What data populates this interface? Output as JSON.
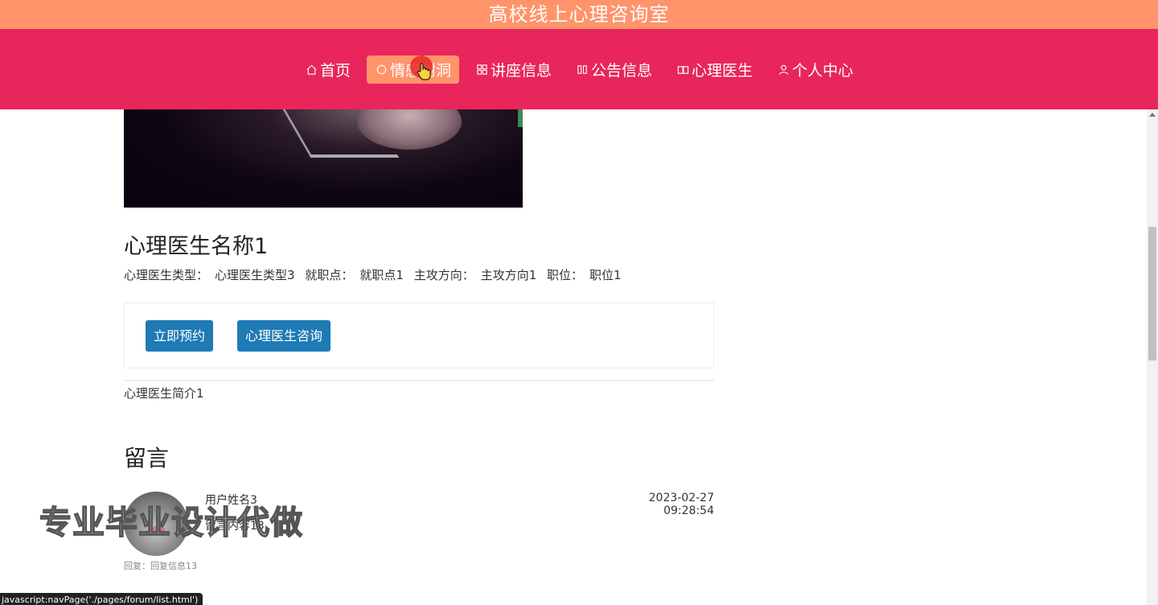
{
  "header": {
    "site_title": "高校线上心理咨询室"
  },
  "nav": {
    "items": [
      {
        "icon": "home-icon",
        "label": "首页",
        "active": false
      },
      {
        "icon": "circle-icon",
        "label": "情感树洞",
        "active": true
      },
      {
        "icon": "grid-icon",
        "label": "讲座信息",
        "active": false
      },
      {
        "icon": "columns-icon",
        "label": "公告信息",
        "active": false
      },
      {
        "icon": "book-icon",
        "label": "心理医生",
        "active": false
      },
      {
        "icon": "user-icon",
        "label": "个人中心",
        "active": false
      }
    ]
  },
  "doctor": {
    "name": "心理医生名称1",
    "meta": [
      {
        "label": "心理医生类型：",
        "value": "心理医生类型3"
      },
      {
        "label": "就职点：",
        "value": "就职点1"
      },
      {
        "label": "主攻方向：",
        "value": "主攻方向1"
      },
      {
        "label": "职位：",
        "value": "职位1"
      }
    ],
    "intro": "心理医生简介1"
  },
  "actions": {
    "book_label": "立即预约",
    "consult_label": "心理医生咨询"
  },
  "comments": {
    "section_title": "留言",
    "items": [
      {
        "user": "用户姓名3",
        "content": "留言内容13",
        "time": "2023-02-27 09:28:54",
        "reply": "回复：回复信息13"
      }
    ]
  },
  "overlay": {
    "watermark": "专业毕业设计代做",
    "status_tip": "javascript:navPage('./pages/forum/list.html')"
  },
  "colors": {
    "topbar": "#ff946a",
    "navbar": "#e8265c",
    "active_nav": "#ff946a",
    "button": "#1e7ab5"
  }
}
